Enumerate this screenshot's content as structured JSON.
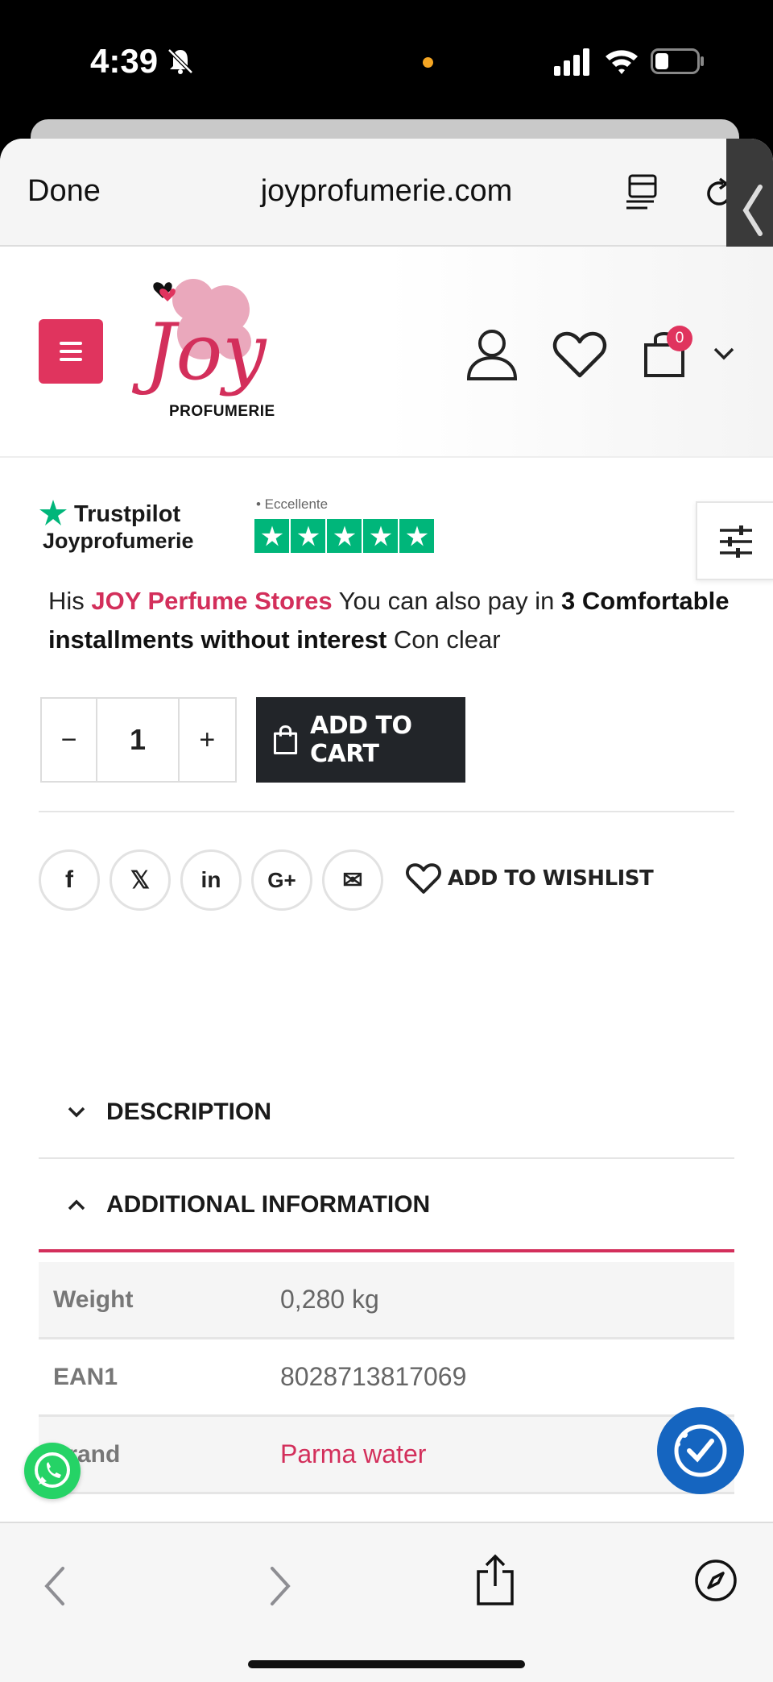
{
  "status_bar": {
    "time": "4:39",
    "icons": [
      "bell-slash-icon",
      "cellular-icon",
      "wifi-icon",
      "battery-icon"
    ]
  },
  "browser": {
    "done_label": "Done",
    "url": "joyprofumerie.com"
  },
  "header": {
    "logo_word": "Joy",
    "logo_sub": "PROFUMERIE",
    "cart_count": "0",
    "brand_color": "#e0345e"
  },
  "trustpilot": {
    "name": "Trustpilot",
    "brand": "Joyprofumerie",
    "rating_label": "• Eccellente",
    "stars": 5
  },
  "promo": {
    "part1": "His ",
    "store": "JOY Perfume Stores",
    "part2": " You can also pay in ",
    "bold": "3 Comfortable installments without interest",
    "part3": " Con clear"
  },
  "purchase": {
    "minus": "−",
    "quantity": "1",
    "plus": "+",
    "add_to_cart": "ADD TO CART"
  },
  "share": {
    "items": [
      {
        "name": "facebook",
        "glyph": "f"
      },
      {
        "name": "x",
        "glyph": "𝕏"
      },
      {
        "name": "linkedin",
        "glyph": "in"
      },
      {
        "name": "google-plus",
        "glyph": "G+"
      },
      {
        "name": "email",
        "glyph": "✉"
      }
    ],
    "wishlist": "ADD TO WISHLIST"
  },
  "tabs": [
    {
      "label": "DESCRIPTION",
      "expanded": false
    },
    {
      "label": "ADDITIONAL INFORMATION",
      "expanded": true
    }
  ],
  "additional_info": [
    {
      "key": "Weight",
      "value": "0,280 kg"
    },
    {
      "key": "EAN1",
      "value": "8028713817069"
    },
    {
      "key": "brand",
      "value": "Parma water"
    }
  ]
}
